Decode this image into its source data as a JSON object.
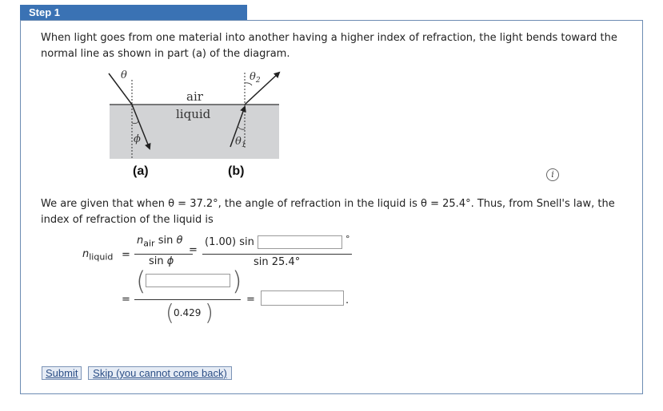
{
  "step": {
    "label": "Step 1"
  },
  "intro_text": "When light goes from one material into another having a higher index of refraction, the light bends toward the normal line as shown in part (a) of the diagram.",
  "diagram": {
    "labels": {
      "air": "air",
      "liquid": "liquid",
      "theta": "θ",
      "phi": "ϕ",
      "theta2": "θ",
      "theta2_sub": "2",
      "theta1": "θ",
      "theta1_sub": "1",
      "part_a": "(a)",
      "part_b": "(b)"
    }
  },
  "info_icon": "info-icon",
  "given_text": "We are given that when θ = 37.2°, the angle of refraction in the liquid is θ = 25.4°. Thus, from Snell's law, the index of refraction of the liquid is",
  "equation": {
    "n": "n",
    "n_liquid_sub": "liquid",
    "n_air_sub": "air",
    "eq": "=",
    "sin": "sin",
    "theta": "θ",
    "phi": "ϕ",
    "n_air_value": "(1.00) sin",
    "denominator": "sin 25.4°",
    "degree": "°",
    "denominator2": "0.429",
    "period": ".",
    "input_angle": "",
    "input_numerator": "",
    "input_result": ""
  },
  "buttons": {
    "submit": "Submit",
    "skip": "Skip (you cannot come back)"
  }
}
